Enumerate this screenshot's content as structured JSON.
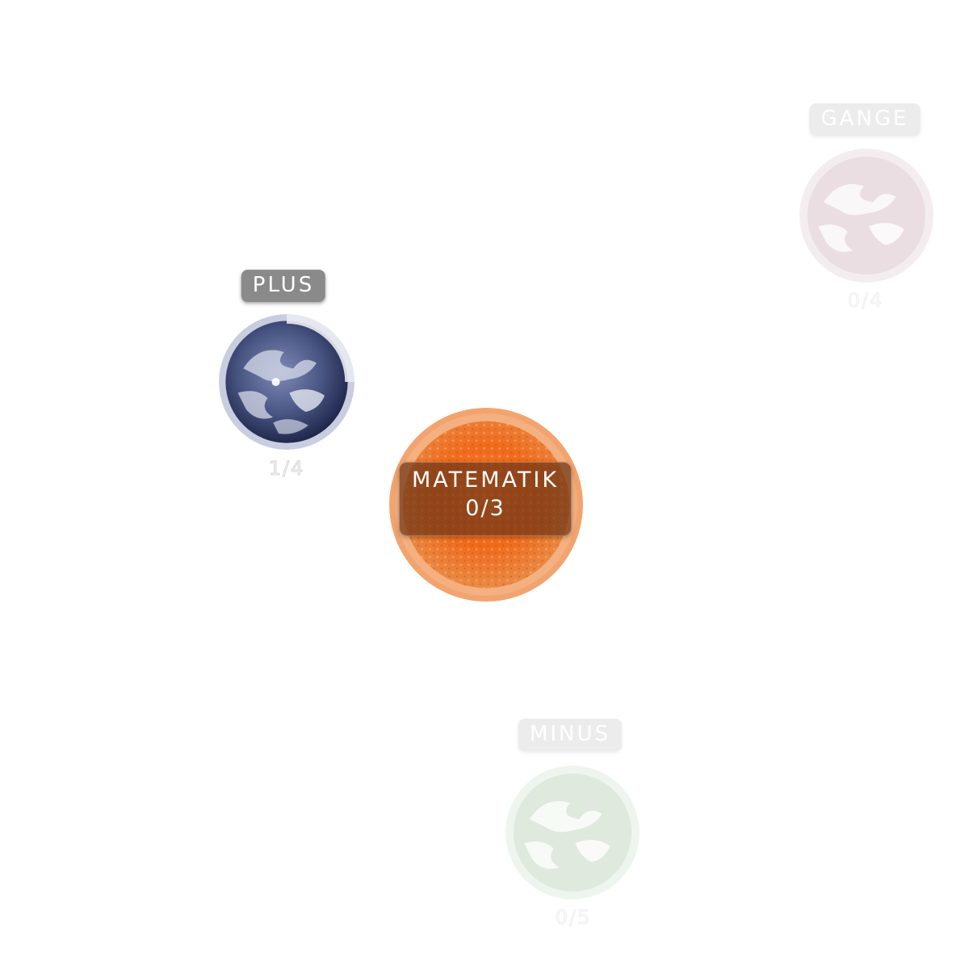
{
  "center": {
    "title": "MATEMATIK",
    "progress": "0/3",
    "icon": "sun-icon",
    "color": "#e8722a"
  },
  "topics": [
    {
      "label": "PLUS",
      "progress": "1/4",
      "completed_fraction": 0.25,
      "state": "active",
      "icon": "earth-planet-icon",
      "color": "#3b4a7a"
    },
    {
      "label": "GANGE",
      "progress": "0/4",
      "completed_fraction": 0,
      "state": "locked",
      "icon": "pink-planet-icon",
      "color": "#c9a6b3"
    },
    {
      "label": "MINUS",
      "progress": "0/5",
      "completed_fraction": 0,
      "state": "locked",
      "icon": "green-planet-icon",
      "color": "#a9c9a4"
    }
  ]
}
